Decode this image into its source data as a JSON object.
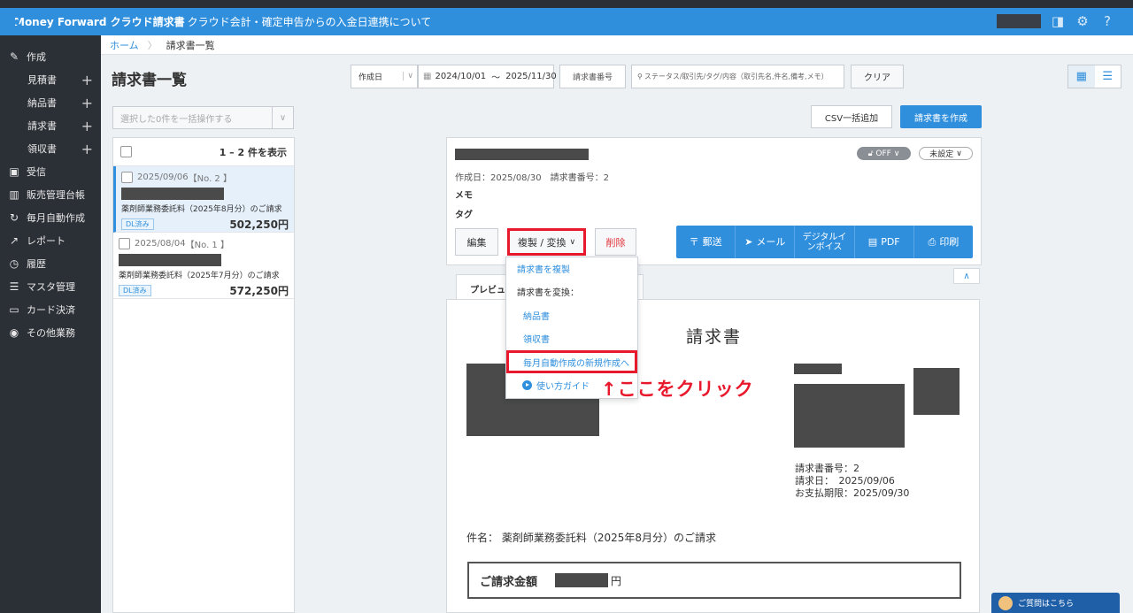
{
  "header": {
    "logo_text": "Money Forward クラウド請求書",
    "notice": "クラウド会計・確定申告からの入金日連携について"
  },
  "sidebar": {
    "items": [
      {
        "label": "作成",
        "icon": "pencil-icon"
      },
      {
        "label": "見積書",
        "sub": true
      },
      {
        "label": "納品書",
        "sub": true
      },
      {
        "label": "請求書",
        "sub": true
      },
      {
        "label": "領収書",
        "sub": true
      },
      {
        "label": "受信",
        "icon": "inbox-icon"
      },
      {
        "label": "販売管理台帳",
        "icon": "ledger-icon"
      },
      {
        "label": "毎月自動作成",
        "icon": "repeat-icon"
      },
      {
        "label": "レポート",
        "icon": "chart-icon"
      },
      {
        "label": "履歴",
        "icon": "history-icon"
      },
      {
        "label": "マスタ管理",
        "icon": "list-icon"
      },
      {
        "label": "カード決済",
        "icon": "card-icon"
      },
      {
        "label": "その他業務",
        "icon": "other-icon"
      }
    ]
  },
  "breadcrumb": {
    "home": "ホーム",
    "current": "請求書一覧"
  },
  "page_title": "請求書一覧",
  "filters": {
    "date_type": "作成日",
    "date_from": "2024/10/01",
    "date_sep": "〜",
    "date_to": "2025/11/30",
    "number_placeholder": "請求書番号",
    "search_placeholder": "ステータス/取引先/タグ/内容（取引先名,件名,備考,メモ）",
    "clear": "クリア"
  },
  "bulk_action": "選択した0件を一括操作する",
  "list": {
    "count_text": "1 – 2 件を表示",
    "items": [
      {
        "date": "2025/09/06",
        "number": "【No. 2 】",
        "subject": "薬剤師業務委託料（2025年8月分）のご請求",
        "badge": "DL済み",
        "amount": "502,250円"
      },
      {
        "date": "2025/08/04",
        "number": "【No. 1 】",
        "subject": "薬剤師業務委託料（2025年7月分）のご請求",
        "badge": "DL済み",
        "amount": "572,250円"
      }
    ]
  },
  "top_buttons": {
    "csv": "CSV一括追加",
    "create": "請求書を作成"
  },
  "detail": {
    "toggle": "OFF",
    "status": "未設定",
    "meta": "作成日：2025/08/30　請求書番号：2",
    "memo": "メモ",
    "tag": "タグ",
    "edit": "編集",
    "copy_convert": "複製 / 変換",
    "delete": "削除",
    "actions": [
      "郵送",
      "メール",
      "デジタルインボイス",
      "PDF",
      "印刷"
    ]
  },
  "dropdown": {
    "copy": "請求書を複製",
    "convert_label": "請求書を変換：",
    "delivery": "納品書",
    "receipt": "領収書",
    "monthly": "毎月自動作成の新規作成へ",
    "guide": "使い方ガイド"
  },
  "annotation": "↑ここをクリック",
  "preview": {
    "tab": "プレビュー",
    "title": "請求書",
    "number_line": "請求書番号：2",
    "date_line": "請求日：　2025/09/06",
    "due_line": "お支払期限：2025/09/30",
    "subject_line": "件名：  薬剤師業務委託料（2025年8月分）のご請求",
    "total_label": "ご請求金額",
    "yen": "円"
  },
  "help": "ご質問はこちら",
  "colors": {
    "brand": "#2f8fdd",
    "highlight": "#e8192c",
    "sidebar": "#2b2f36"
  }
}
